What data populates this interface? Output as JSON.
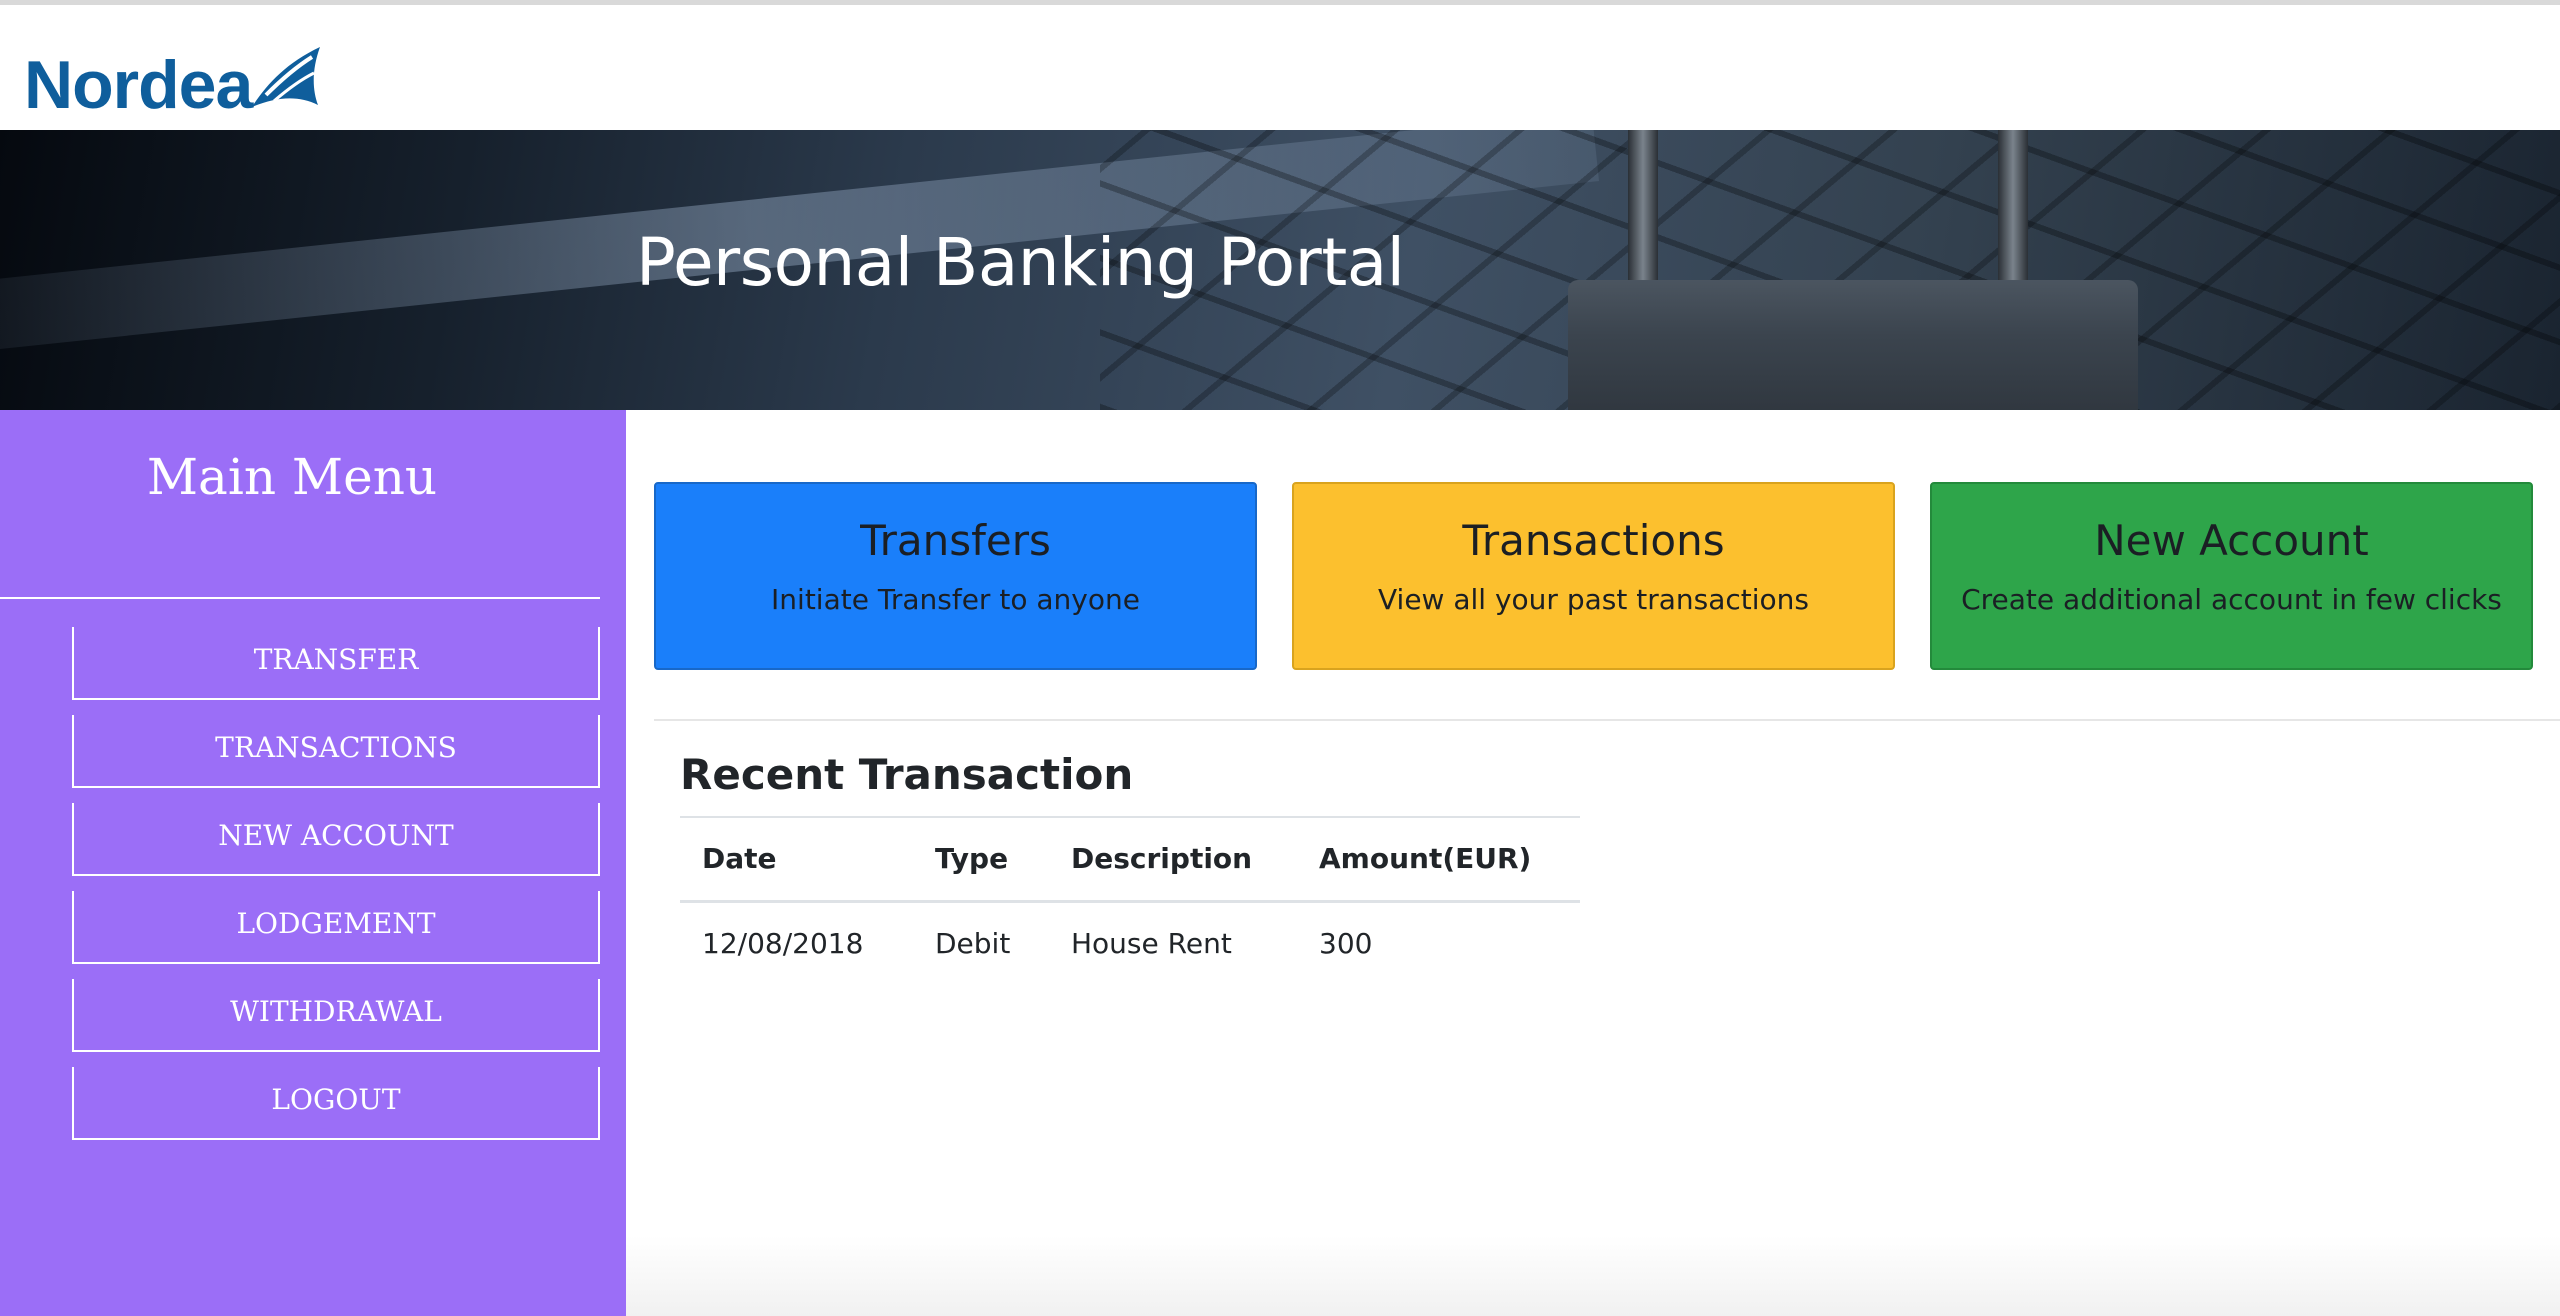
{
  "brand": {
    "name": "Nordea",
    "logo_color": "#0f5e9c"
  },
  "hero": {
    "title": "Personal Banking Portal"
  },
  "sidebar": {
    "title": "Main Menu",
    "bg_color": "#9b6ef7",
    "items": [
      {
        "label": "TRANSFER"
      },
      {
        "label": "TRANSACTIONS"
      },
      {
        "label": "NEW ACCOUNT"
      },
      {
        "label": "LODGEMENT"
      },
      {
        "label": "WITHDRAWAL"
      },
      {
        "label": "LOGOUT"
      }
    ]
  },
  "cards": [
    {
      "title": "Transfers",
      "subtitle": "Initiate Transfer to anyone",
      "color": "#1a7ffa"
    },
    {
      "title": "Transactions",
      "subtitle": "View all your past transactions",
      "color": "#fcc02e"
    },
    {
      "title": "New Account",
      "subtitle": "Create additional account in few clicks",
      "color": "#2ea54a"
    }
  ],
  "recent": {
    "title": "Recent Transaction",
    "columns": [
      "Date",
      "Type",
      "Description",
      "Amount(EUR)"
    ],
    "rows": [
      {
        "date": "12/08/2018",
        "type": "Debit",
        "description": "House Rent",
        "amount": "300"
      }
    ]
  }
}
